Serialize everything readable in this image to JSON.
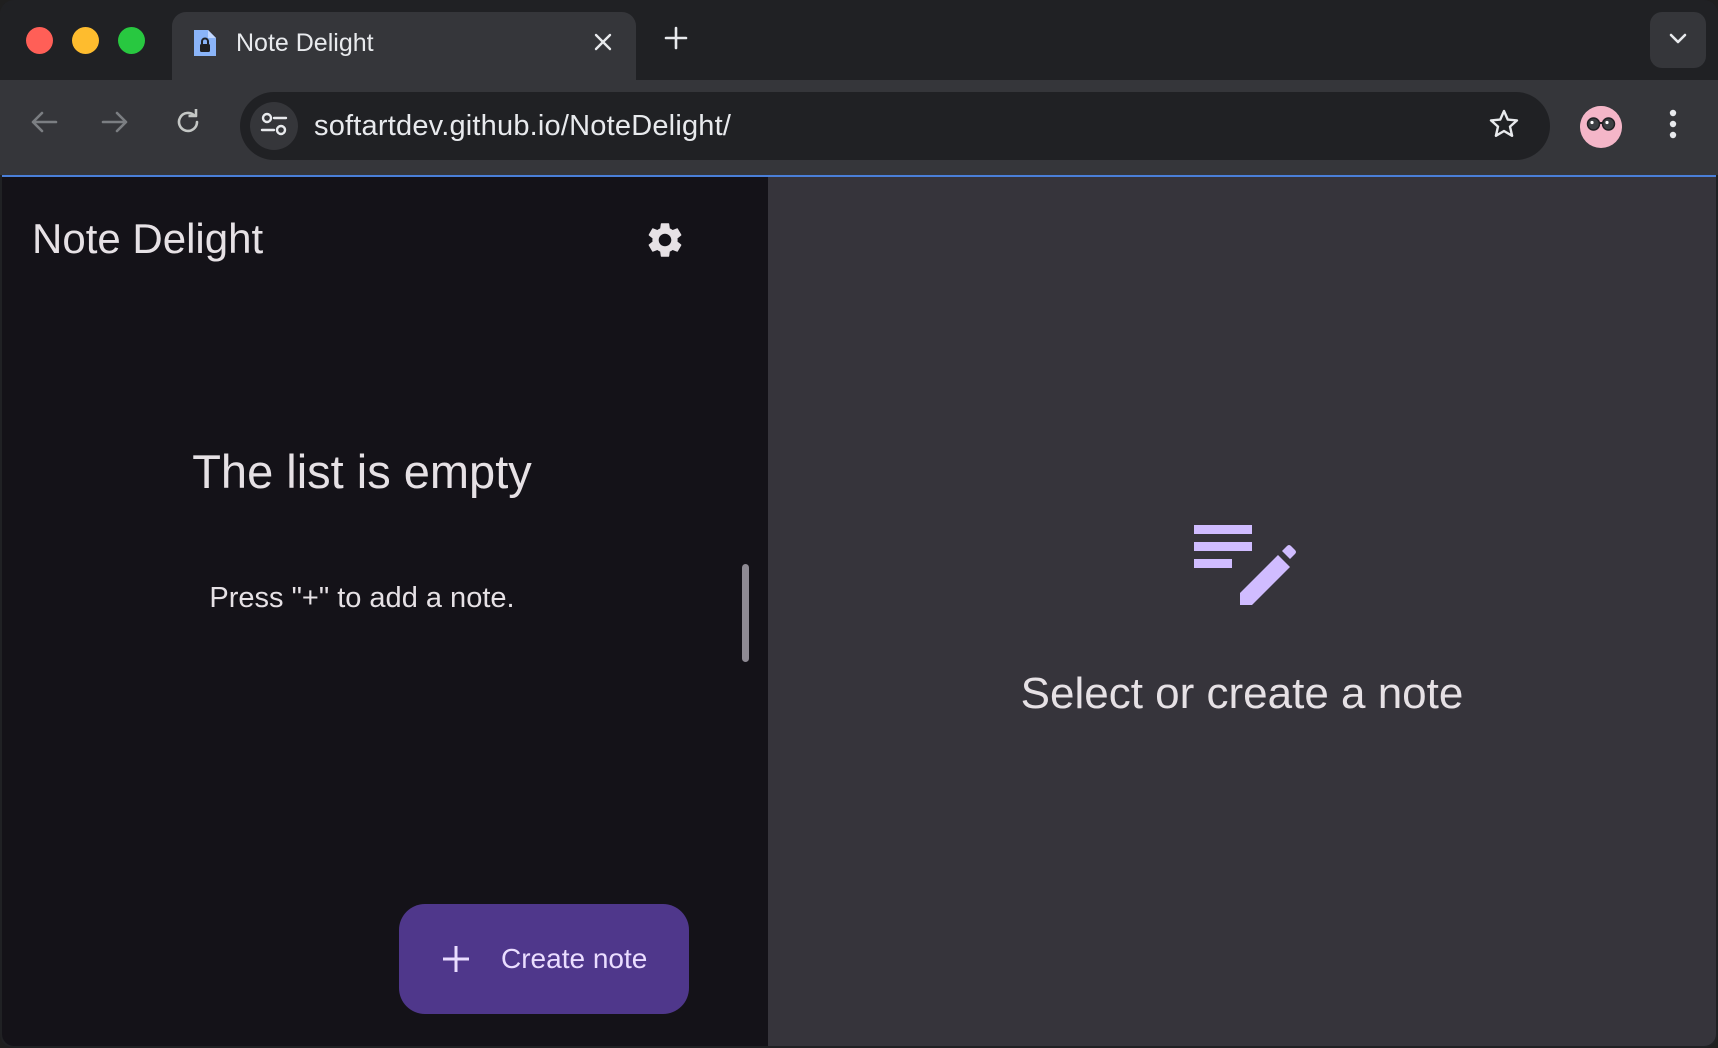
{
  "browser": {
    "tab": {
      "title": "Note Delight",
      "favicon": "document-lock-icon"
    },
    "address_bar": {
      "url_host": "softartdev.github.io",
      "url_path": "/NoteDelight/"
    },
    "icons": {
      "close_tab": "close-icon",
      "new_tab": "plus-icon",
      "tab_search": "chevron-down-icon",
      "back": "arrow-left-icon",
      "forward": "arrow-right-icon",
      "reload": "reload-icon",
      "site_info": "tune-icon",
      "bookmark": "star-icon",
      "profile": "avatar-icon",
      "menu": "more-vertical-icon"
    }
  },
  "app": {
    "title": "Note Delight",
    "settings_icon": "gear-icon",
    "list": {
      "empty_title": "The list is empty",
      "empty_hint": "Press \"+\" to add a note."
    },
    "fab": {
      "label": "Create note",
      "icon": "plus-icon"
    },
    "detail": {
      "icon": "edit-note-icon",
      "prompt": "Select or create a note"
    }
  },
  "colors": {
    "sidebar_bg": "#141218",
    "detail_bg": "#36343b",
    "fab_bg": "#4f378b",
    "accent": "#d0bcff",
    "text": "#e6e1e5"
  }
}
